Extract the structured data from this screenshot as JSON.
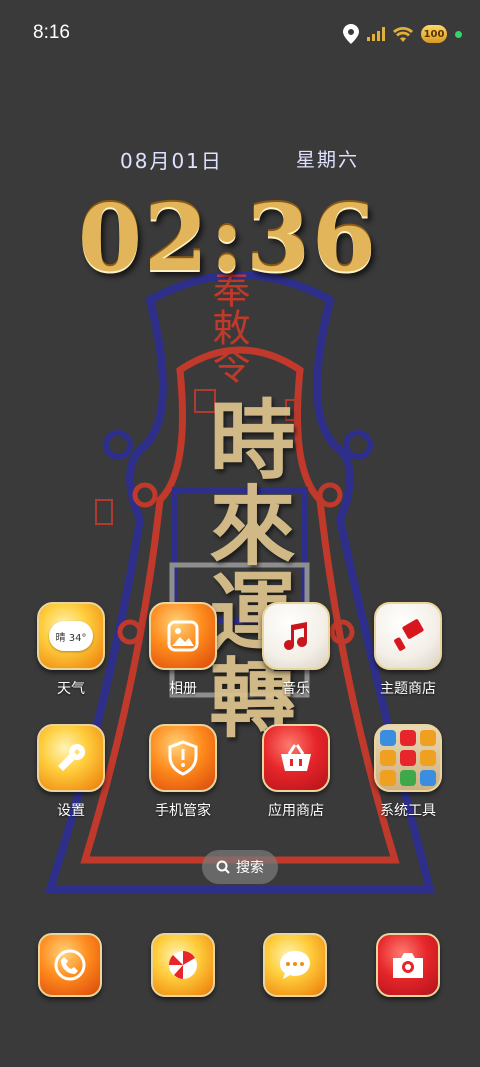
{
  "status_bar": {
    "time": "8:16",
    "battery_text": "100",
    "icons": [
      "location-icon",
      "signal-icon",
      "wifi-icon",
      "battery-icon",
      "privacy-dot-icon"
    ]
  },
  "lock_widget": {
    "date": "08月01日",
    "weekday": "星期六",
    "clock": "02:36"
  },
  "apps": [
    {
      "label": "天气",
      "icon": "weather-icon",
      "badge": "晴 34°"
    },
    {
      "label": "相册",
      "icon": "gallery-icon"
    },
    {
      "label": "音乐",
      "icon": "music-icon"
    },
    {
      "label": "主题商店",
      "icon": "theme-store-icon"
    },
    {
      "label": "设置",
      "icon": "settings-wrench-icon"
    },
    {
      "label": "手机管家",
      "icon": "shield-icon"
    },
    {
      "label": "应用商店",
      "icon": "app-store-basket-icon"
    },
    {
      "label": "系统工具",
      "icon": "folder-icon"
    }
  ],
  "search": {
    "label": "搜索"
  },
  "dock": [
    {
      "icon": "phone-icon"
    },
    {
      "icon": "browser-icon"
    },
    {
      "icon": "messages-icon"
    },
    {
      "icon": "camera-icon"
    }
  ],
  "wallpaper": {
    "main_text": "時來運轉",
    "seal_text": "奉敕令",
    "colors": {
      "blue": "#2e2f8a",
      "red": "#c0392b",
      "gold": "#e2b55a"
    }
  }
}
